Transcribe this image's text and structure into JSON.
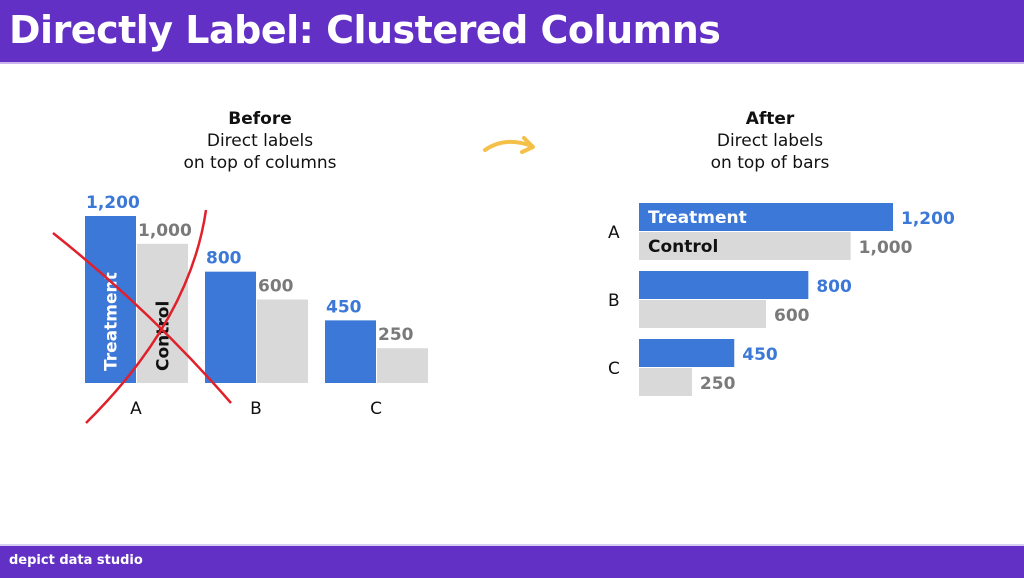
{
  "header": {
    "title": "Directly Label: Clustered Columns"
  },
  "footer": {
    "brand": "depict data studio"
  },
  "colors": {
    "brand": "#6230c4",
    "treatment": "#3b78d8",
    "control": "#d9d9d9",
    "control_label": "#7a7a7a",
    "cross": "#e0202a",
    "arrow": "#f5c04a"
  },
  "before": {
    "title": "Before",
    "line1": "Direct labels",
    "line2": "on top of columns"
  },
  "after": {
    "title": "After",
    "line1": "Direct labels",
    "line2": "on top of bars"
  },
  "arrow_icon": "curved-arrow-right",
  "chart_data": [
    {
      "type": "bar",
      "orientation": "vertical",
      "title": "Before",
      "subtitle": "Direct labels on top of columns",
      "categories": [
        "A",
        "B",
        "C"
      ],
      "series": [
        {
          "name": "Treatment",
          "values": [
            1200,
            800,
            450
          ]
        },
        {
          "name": "Control",
          "values": [
            1000,
            600,
            250
          ]
        }
      ],
      "value_labels": {
        "Treatment": [
          "1,200",
          "800",
          "450"
        ],
        "Control": [
          "1,000",
          "600",
          "250"
        ]
      },
      "series_labels_inside_first_cluster": true,
      "crossed_out": true,
      "ylim": [
        0,
        1200
      ],
      "grid": false
    },
    {
      "type": "bar",
      "orientation": "horizontal",
      "title": "After",
      "subtitle": "Direct labels on top of bars",
      "categories": [
        "A",
        "B",
        "C"
      ],
      "series": [
        {
          "name": "Treatment",
          "values": [
            1200,
            800,
            450
          ]
        },
        {
          "name": "Control",
          "values": [
            1000,
            600,
            250
          ]
        }
      ],
      "value_labels": {
        "Treatment": [
          "1,200",
          "800",
          "450"
        ],
        "Control": [
          "1,000",
          "600",
          "250"
        ]
      },
      "series_labels_inside_first_cluster": true,
      "xlim": [
        0,
        1200
      ],
      "grid": false
    }
  ]
}
